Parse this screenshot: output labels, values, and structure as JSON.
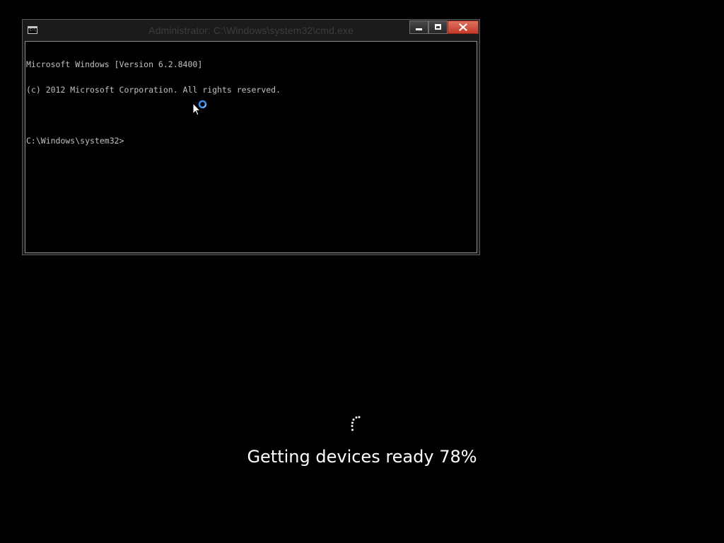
{
  "window": {
    "title": "Administrator: C:\\Windows\\system32\\cmd.exe",
    "icon": "cmd-app-icon",
    "icon_glyph": "C:\\.",
    "controls": {
      "minimize_icon": "minimize-icon",
      "maximize_icon": "maximize-icon",
      "close_icon": "close-icon"
    }
  },
  "console": {
    "lines": [
      "Microsoft Windows [Version 6.2.8400]",
      "(c) 2012 Microsoft Corporation. All rights reserved.",
      "",
      "C:\\Windows\\system32>"
    ]
  },
  "pointer": {
    "icon": "busy-pointer-icon"
  },
  "boot": {
    "spinner_icon": "loading-dots-icon",
    "status": "Getting devices ready 78%",
    "progress_percent": 78
  },
  "colors": {
    "background": "#000000",
    "console_text": "#c0c0c0",
    "close_button": "#c43b29",
    "busy_ring": "#3a8ee6",
    "status_text": "#ffffff"
  }
}
